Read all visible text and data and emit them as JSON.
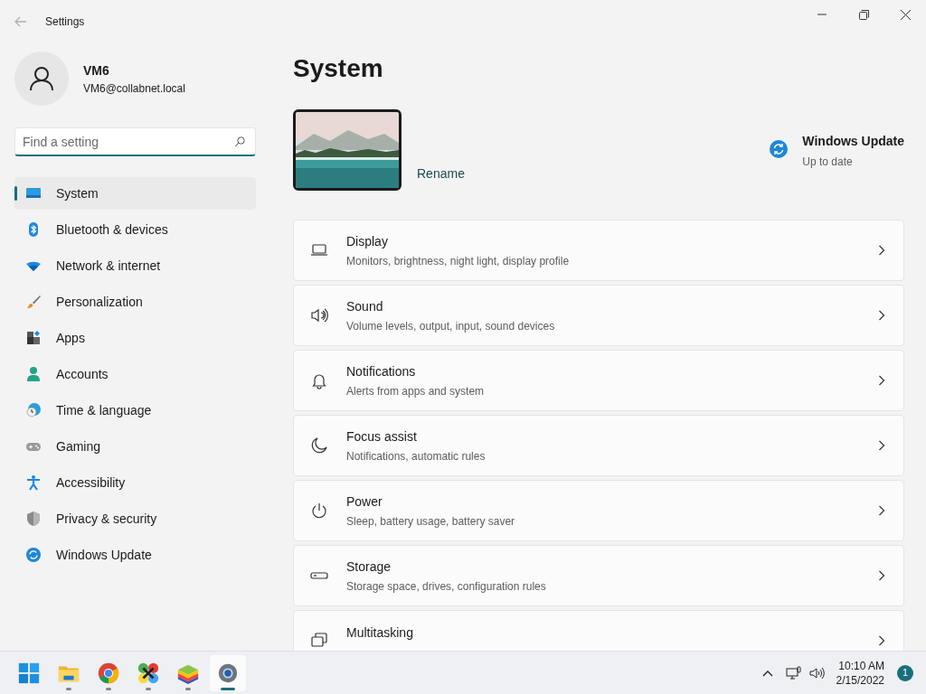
{
  "window": {
    "title": "Settings"
  },
  "account": {
    "name": "VM6",
    "email": "VM6@collabnet.local"
  },
  "search": {
    "placeholder": "Find a setting"
  },
  "sidebar": {
    "items": [
      {
        "label": "System",
        "selected": true
      },
      {
        "label": "Bluetooth & devices",
        "selected": false
      },
      {
        "label": "Network & internet",
        "selected": false
      },
      {
        "label": "Personalization",
        "selected": false
      },
      {
        "label": "Apps",
        "selected": false
      },
      {
        "label": "Accounts",
        "selected": false
      },
      {
        "label": "Time & language",
        "selected": false
      },
      {
        "label": "Gaming",
        "selected": false
      },
      {
        "label": "Accessibility",
        "selected": false
      },
      {
        "label": "Privacy & security",
        "selected": false
      },
      {
        "label": "Windows Update",
        "selected": false
      }
    ]
  },
  "page": {
    "title": "System"
  },
  "device": {
    "action": "Rename"
  },
  "update_status": {
    "title": "Windows Update",
    "status": "Up to date"
  },
  "settings": [
    {
      "title": "Display",
      "description": "Monitors, brightness, night light, display profile"
    },
    {
      "title": "Sound",
      "description": "Volume levels, output, input, sound devices"
    },
    {
      "title": "Notifications",
      "description": "Alerts from apps and system"
    },
    {
      "title": "Focus assist",
      "description": "Notifications, automatic rules"
    },
    {
      "title": "Power",
      "description": "Sleep, battery usage, battery saver"
    },
    {
      "title": "Storage",
      "description": "Storage space, drives, configuration rules"
    },
    {
      "title": "Multitasking"
    }
  ],
  "taskbar": {
    "apps": [
      {
        "running": false,
        "selected": false
      },
      {
        "running": true,
        "selected": false
      },
      {
        "running": true,
        "selected": false
      },
      {
        "running": true,
        "selected": false
      },
      {
        "running": true,
        "selected": false
      },
      {
        "running": true,
        "selected": true
      }
    ],
    "time": "10:10 AM",
    "date": "2/15/2022",
    "notification_count": "1"
  }
}
